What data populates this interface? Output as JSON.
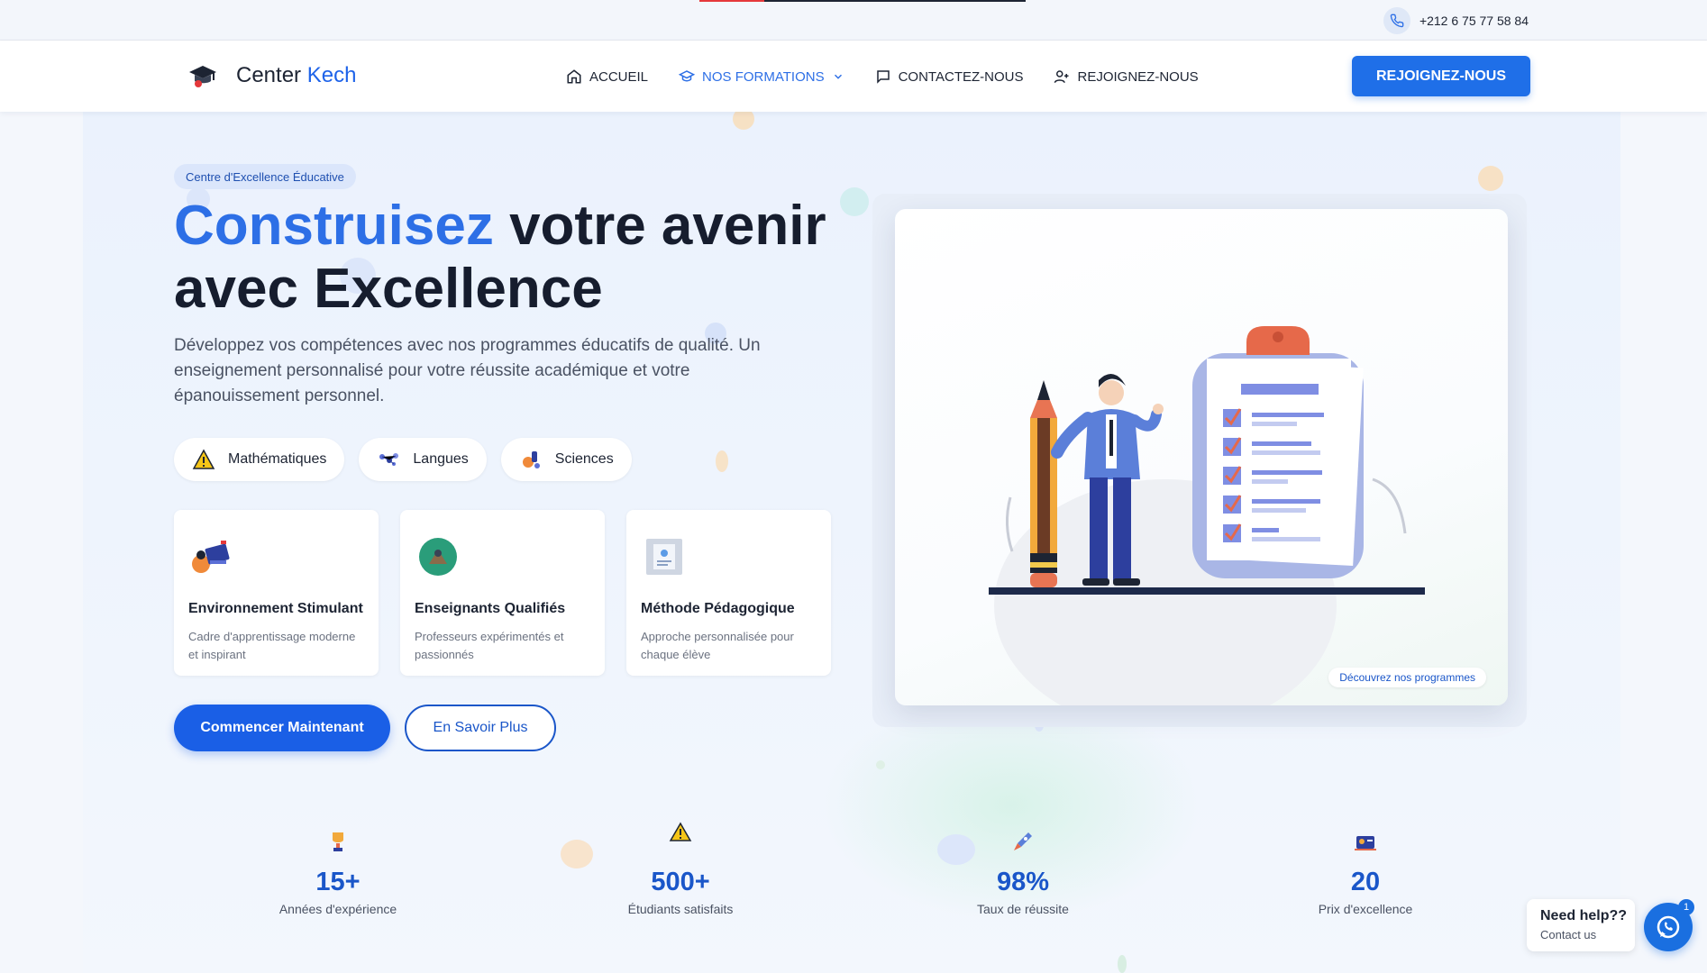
{
  "topbar": {
    "phone": "+212 6 75 77 58 84"
  },
  "navbar": {
    "brand_part1": "Center",
    "brand_part2": "Kech",
    "links": [
      {
        "label": "ACCUEIL",
        "icon": "home-icon"
      },
      {
        "label": "NOS FORMATIONS",
        "icon": "graduation-cap-icon",
        "active": true
      },
      {
        "label": "CONTACTEZ-NOUS",
        "icon": "message-icon"
      },
      {
        "label": "REJOIGNEZ-NOUS",
        "icon": "user-plus-icon"
      }
    ],
    "cta": "REJOIGNEZ-NOUS"
  },
  "hero": {
    "badge": "Centre d'Excellence Éducative",
    "title_highlight": "Construisez",
    "title_rest_line1": " votre avenir",
    "title_line2": "avec Excellence",
    "subtitle": "Développez vos compétences avec nos programmes éducatifs de qualité. Un enseignement personnalisé pour votre réussite académique et votre épanouissement personnel.",
    "chips": [
      "Mathématiques",
      "Langues",
      "Sciences"
    ],
    "features": [
      {
        "title": "Environnement Stimulant",
        "desc": "Cadre d'apprentissage moderne et inspirant"
      },
      {
        "title": "Enseignants Qualifiés",
        "desc": "Professeurs expérimentés et passionnés"
      },
      {
        "title": "Méthode Pédagogique",
        "desc": "Approche personnalisée pour chaque élève"
      }
    ],
    "primary_button": "Commencer Maintenant",
    "secondary_button": "En Savoir Plus",
    "illustration_tag": "Découvrez nos programmes"
  },
  "stats": [
    {
      "value": "15+",
      "label": "Années d'expérience",
      "icon": "trophy-icon"
    },
    {
      "value": "500+",
      "label": "Étudiants satisfaits",
      "icon": "warning-icon"
    },
    {
      "value": "98%",
      "label": "Taux de réussite",
      "icon": "rocket-icon"
    },
    {
      "value": "20",
      "label": "Prix d'excellence",
      "icon": "award-icon"
    }
  ],
  "help_widget": {
    "title": "Need help??",
    "subtitle": "Contact us",
    "badge_count": "1"
  },
  "colors": {
    "primary": "#1a5fe6",
    "accent_text": "#2d6fe6",
    "dark": "#161d2e"
  }
}
